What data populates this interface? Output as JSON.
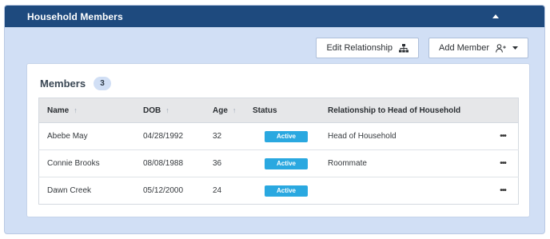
{
  "panel": {
    "title": "Household Members"
  },
  "toolbar": {
    "edit_relationship_label": "Edit Relationship",
    "add_member_label": "Add Member"
  },
  "members": {
    "title": "Members",
    "count": "3",
    "columns": {
      "name": "Name",
      "dob": "DOB",
      "age": "Age",
      "status": "Status",
      "relationship": "Relationship to Head of Household"
    },
    "rows": [
      {
        "name": "Abebe May",
        "dob": "04/28/1992",
        "age": "32",
        "status": "Active",
        "relationship": "Head of Household",
        "more": "•••"
      },
      {
        "name": "Connie Brooks",
        "dob": "08/08/1988",
        "age": "36",
        "status": "Active",
        "relationship": "Roommate",
        "more": "•••"
      },
      {
        "name": "Dawn Creek",
        "dob": "05/12/2000",
        "age": "24",
        "status": "Active",
        "relationship": "",
        "more": "•••"
      }
    ]
  },
  "colors": {
    "header_bg": "#1e4a7e",
    "panel_bg": "#d1dff5",
    "status_active": "#2aa8e0"
  },
  "icons": {
    "collapse": "caret-up-icon",
    "sort": "sort-arrow-icon",
    "edit_relationship": "hierarchy-icon",
    "add_member": "add-person-icon",
    "dropdown": "caret-down-icon",
    "row_menu": "more-horizontal-icon"
  }
}
